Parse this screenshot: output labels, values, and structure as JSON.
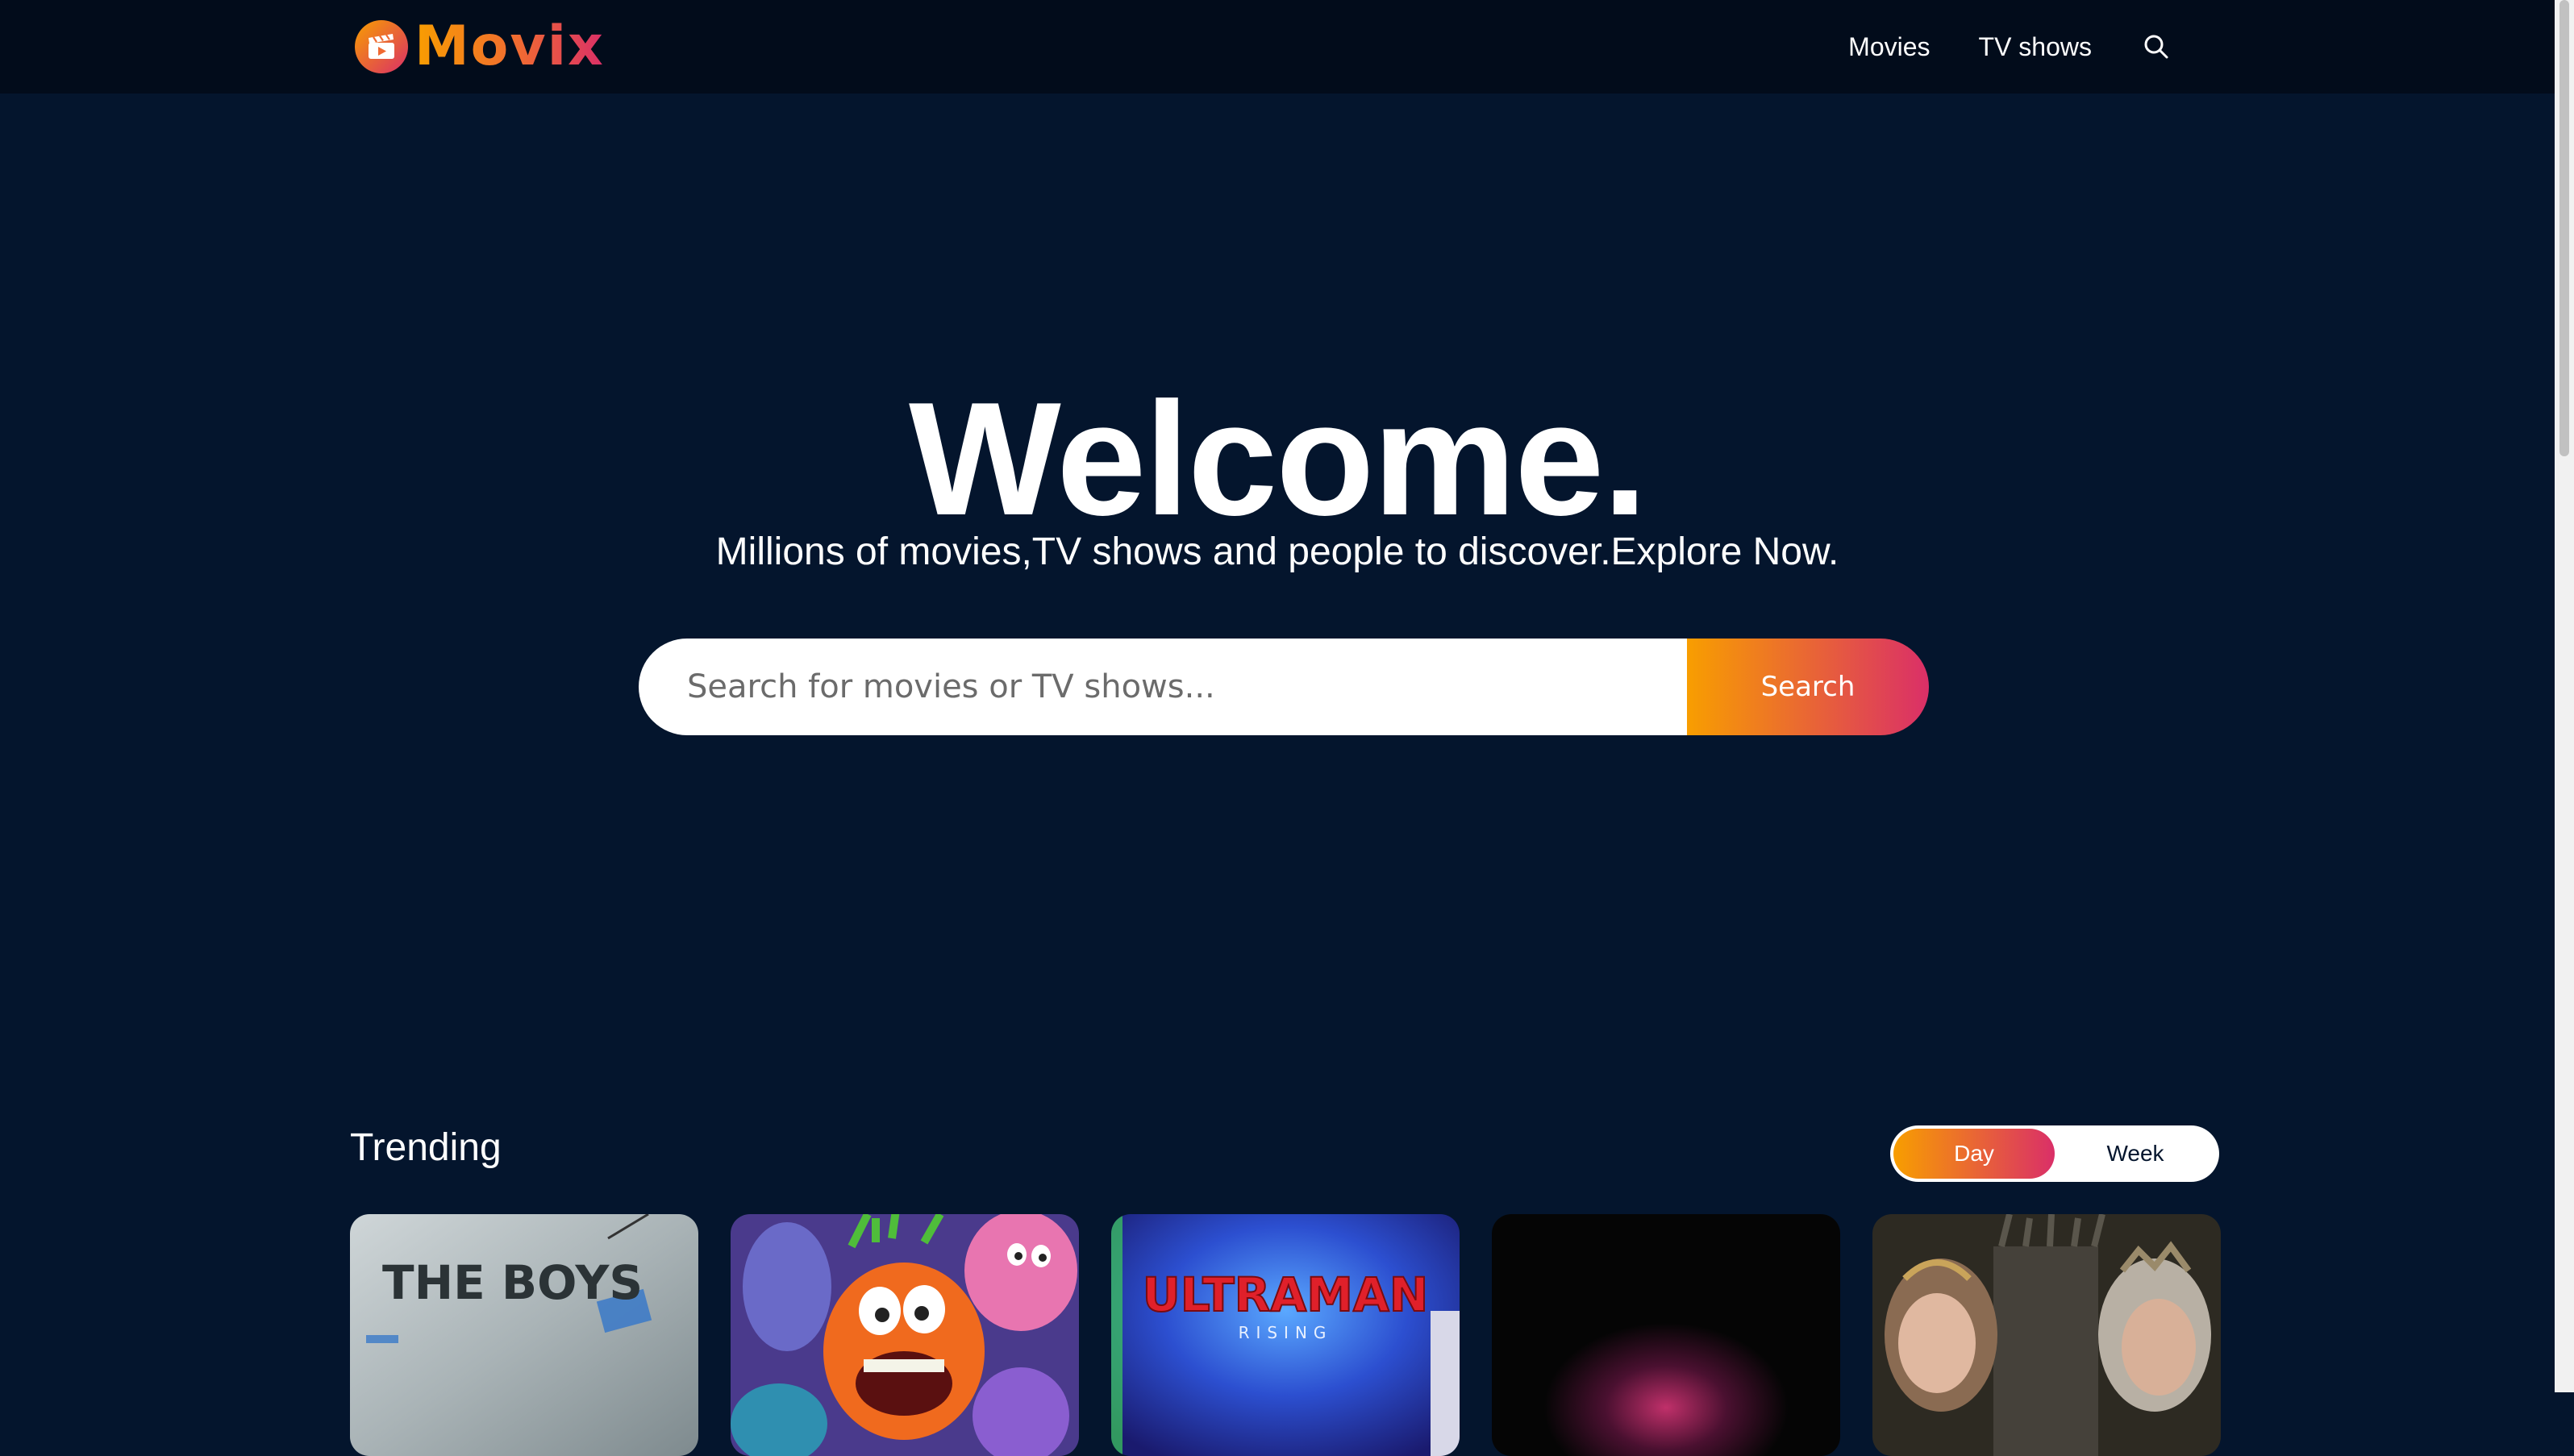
{
  "header": {
    "logo_text": "Movix",
    "nav": [
      {
        "label": "Movies"
      },
      {
        "label": "TV shows"
      }
    ],
    "search_icon": "search-icon"
  },
  "hero": {
    "title": "Welcome.",
    "subtitle": "Millions of movies,TV shows and people to discover.Explore Now.",
    "search_placeholder": "Search for movies or TV shows...",
    "search_button": "Search"
  },
  "trending": {
    "title": "Trending",
    "tabs": [
      {
        "label": "Day",
        "active": true
      },
      {
        "label": "Week",
        "active": false
      }
    ],
    "cards": [
      {
        "name": "poster-the-boys",
        "poster_text": "THE BOYS"
      },
      {
        "name": "poster-inside-out-2"
      },
      {
        "name": "poster-ultraman-rising",
        "poster_text": "ULTRAMAN",
        "poster_subtext": "RISING"
      },
      {
        "name": "poster-dark"
      },
      {
        "name": "poster-house-of-the-dragon"
      }
    ]
  },
  "colors": {
    "background": "#04152d",
    "header_bg": "#020c1b",
    "gradient_start": "#f89e00",
    "gradient_end": "#da2f68"
  }
}
